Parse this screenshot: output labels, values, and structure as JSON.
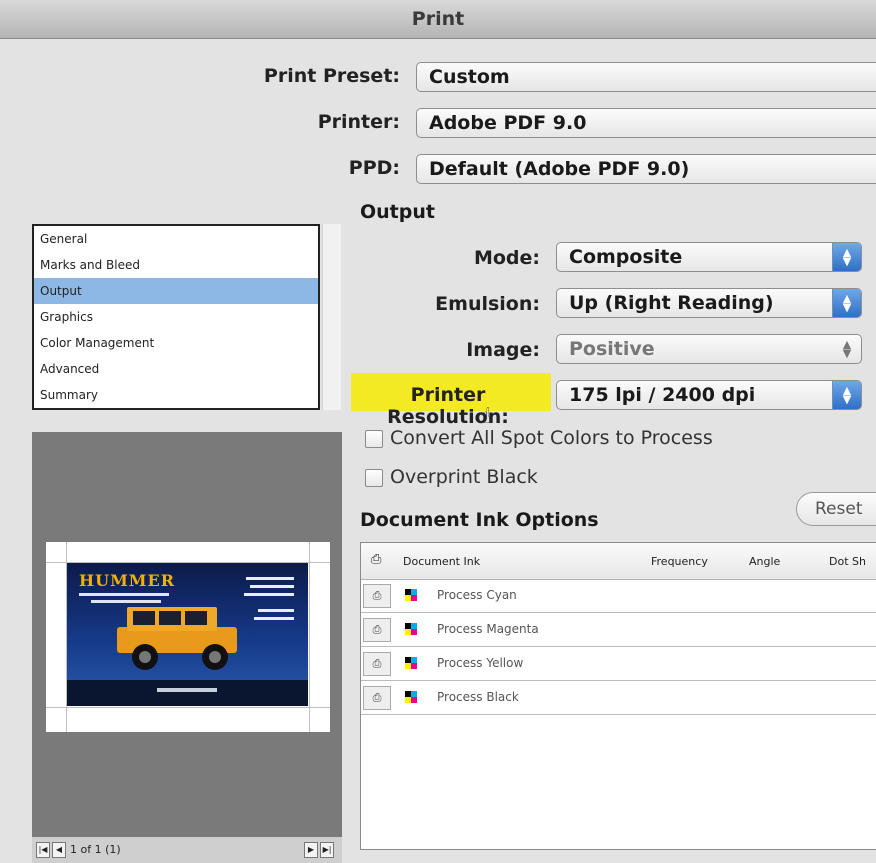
{
  "window": {
    "title": "Print"
  },
  "print_preset": {
    "label": "Print Preset:",
    "value": "Custom"
  },
  "printer": {
    "label": "Printer:",
    "value": "Adobe PDF 9.0"
  },
  "ppd": {
    "label": "PPD:",
    "value": "Default (Adobe PDF 9.0)"
  },
  "sidebar": {
    "items": [
      {
        "label": "General"
      },
      {
        "label": "Marks and Bleed"
      },
      {
        "label": "Output"
      },
      {
        "label": "Graphics"
      },
      {
        "label": "Color Management"
      },
      {
        "label": "Advanced"
      },
      {
        "label": "Summary"
      }
    ],
    "selected": "Output"
  },
  "output": {
    "section_title": "Output",
    "mode": {
      "label": "Mode:",
      "value": "Composite"
    },
    "emulsion": {
      "label": "Emulsion:",
      "value": "Up (Right Reading)"
    },
    "image": {
      "label": "Image:",
      "value": "Positive"
    },
    "printer_resolution": {
      "label": "Printer Resolution:",
      "value": "175 lpi / 2400 dpi"
    },
    "convert_spot": {
      "label": "Convert All Spot Colors to Process",
      "checked": false
    },
    "overprint_black": {
      "label": "Overprint Black",
      "checked": false
    }
  },
  "ink_options": {
    "section_title": "Document Ink Options",
    "reset_label": "Reset",
    "columns": [
      "Document Ink",
      "Frequency",
      "Angle",
      "Dot Sh"
    ],
    "rows": [
      {
        "name": "Process Cyan"
      },
      {
        "name": "Process Magenta"
      },
      {
        "name": "Process Yellow"
      },
      {
        "name": "Process Black"
      }
    ]
  },
  "preview": {
    "page_counter": "1 of 1 (1)",
    "card": {
      "logo": "HUMMER"
    }
  },
  "colors": {
    "highlight": "#f3ea24",
    "selection": "#8db8e6",
    "popup_accent": "#2f6fc7"
  }
}
